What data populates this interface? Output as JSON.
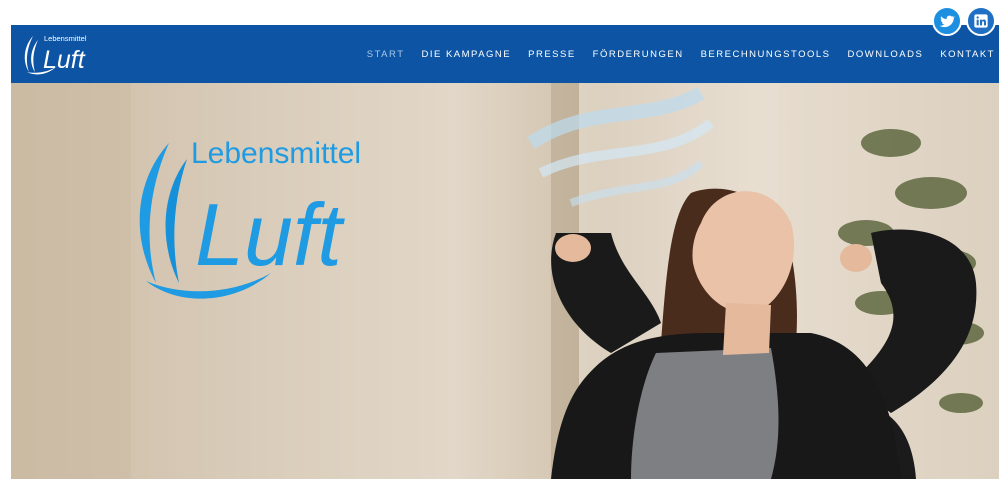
{
  "header": {
    "logo_small_top": "Lebensmittel",
    "logo_small_main": "Luft",
    "nav": [
      {
        "label": "START",
        "active": true
      },
      {
        "label": "DIE KAMPAGNE"
      },
      {
        "label": "PRESSE"
      },
      {
        "label": "FÖRDERUNGEN"
      },
      {
        "label": "BERECHNUNGSTOOLS"
      },
      {
        "label": "DOWNLOADS"
      },
      {
        "label": "KONTAKT"
      }
    ]
  },
  "social": [
    {
      "icon": "twitter-icon"
    },
    {
      "icon": "linkedin-icon"
    }
  ],
  "hero": {
    "logo_top": "Lebensmittel",
    "logo_main": "Luft"
  },
  "colors": {
    "header_bg": "#0d55a4",
    "logo_blue": "#1e9be2",
    "active_nav": "#a8c7ea"
  }
}
